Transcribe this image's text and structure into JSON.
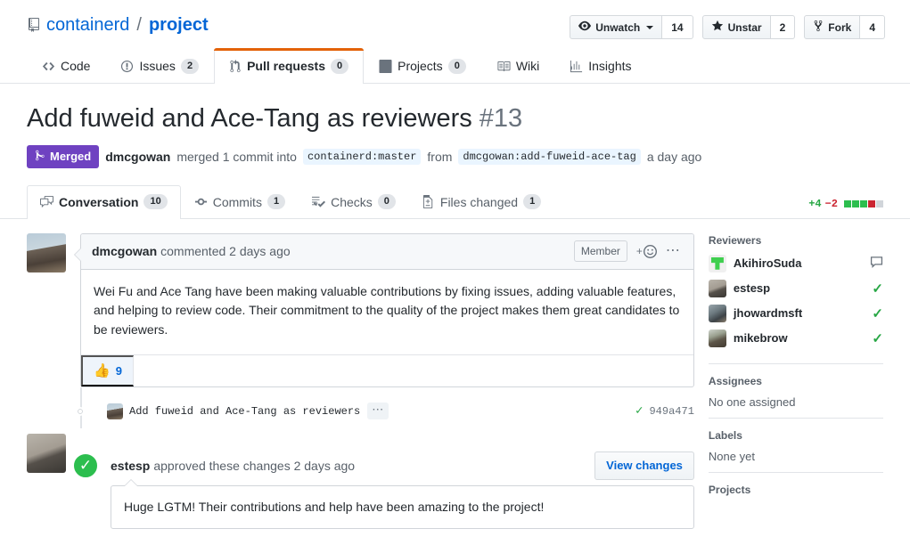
{
  "repo": {
    "owner": "containerd",
    "separator": "/",
    "name": "project",
    "icon": "repo-icon"
  },
  "actions": [
    {
      "label": "Unwatch",
      "count": "14",
      "icon": "eye-icon",
      "has_caret": true
    },
    {
      "label": "Unstar",
      "count": "2",
      "icon": "star-icon",
      "has_caret": false
    },
    {
      "label": "Fork",
      "count": "4",
      "icon": "fork-icon",
      "has_caret": false
    }
  ],
  "repo_nav": [
    {
      "label": "Code",
      "count": null,
      "icon": "code-icon",
      "selected": false
    },
    {
      "label": "Issues",
      "count": "2",
      "icon": "issue-opened-icon",
      "selected": false
    },
    {
      "label": "Pull requests",
      "count": "0",
      "icon": "git-pull-request-icon",
      "selected": true
    },
    {
      "label": "Projects",
      "count": "0",
      "icon": "project-board-icon",
      "selected": false
    },
    {
      "label": "Wiki",
      "count": null,
      "icon": "book-icon",
      "selected": false
    },
    {
      "label": "Insights",
      "count": null,
      "icon": "graph-icon",
      "selected": false
    }
  ],
  "pull_request": {
    "title": "Add fuweid and Ace-Tang as reviewers",
    "number": "#13",
    "state": "Merged",
    "state_icon": "git-merge-icon",
    "state_color": "#6f42c1",
    "merged_by": "dmcgowan",
    "merge_text": "merged 1 commit into",
    "base_branch": "containerd:master",
    "from_word": "from",
    "head_branch": "dmcgowan:add-fuweid-ace-tag",
    "merged_when": "a day ago"
  },
  "pr_tabs": [
    {
      "label": "Conversation",
      "count": "10",
      "icon": "comment-discussion-icon",
      "selected": true
    },
    {
      "label": "Commits",
      "count": "1",
      "icon": "git-commit-icon",
      "selected": false
    },
    {
      "label": "Checks",
      "count": "0",
      "icon": "checklist-icon",
      "selected": false
    },
    {
      "label": "Files changed",
      "count": "1",
      "icon": "diff-icon",
      "selected": false
    }
  ],
  "diffstat": {
    "additions": "+4",
    "deletions": "−2",
    "blocks": [
      "add",
      "add",
      "add",
      "del",
      "neutral"
    ]
  },
  "comment": {
    "author": "dmcgowan",
    "action": "commented 2 days ago",
    "association": "Member",
    "reaction_icon": "add-reaction-icon",
    "menu_icon": "kebab-horizontal-icon",
    "body": "Wei Fu and Ace Tang have been making valuable contributions by fixing issues, adding valuable features, and helping to review code. Their commitment to the quality of the project makes them great candidates to be reviewers.",
    "reaction": {
      "emoji": "👍",
      "count": "9",
      "name": "thumbs-up-reaction"
    }
  },
  "commit_event": {
    "message": "Add fuweid and Ace-Tang as reviewers",
    "menu_icon": "kebab-horizontal-icon",
    "status_icon": "check-icon",
    "sha": "949a471"
  },
  "review": {
    "badge_icon": "check-icon",
    "author": "estesp",
    "action": "approved these changes 2 days ago",
    "button_label": "View changes",
    "body": "Huge LGTM! Their contributions and help have been amazing to the project!"
  },
  "sidebar": {
    "reviewers": {
      "title": "Reviewers",
      "items": [
        {
          "name": "AkihiroSuda",
          "state": "commented",
          "state_icon": "comment-icon",
          "avatar": "av-akihiro"
        },
        {
          "name": "estesp",
          "state": "approved",
          "state_icon": "check-icon",
          "avatar": "av-estesp"
        },
        {
          "name": "jhowardmsft",
          "state": "approved",
          "state_icon": "check-icon",
          "avatar": "av-jhoward"
        },
        {
          "name": "mikebrow",
          "state": "approved",
          "state_icon": "check-icon",
          "avatar": "av-mikebrow"
        }
      ]
    },
    "assignees": {
      "title": "Assignees",
      "empty": "No one assigned"
    },
    "labels": {
      "title": "Labels",
      "empty": "None yet"
    },
    "projects": {
      "title": "Projects"
    }
  }
}
